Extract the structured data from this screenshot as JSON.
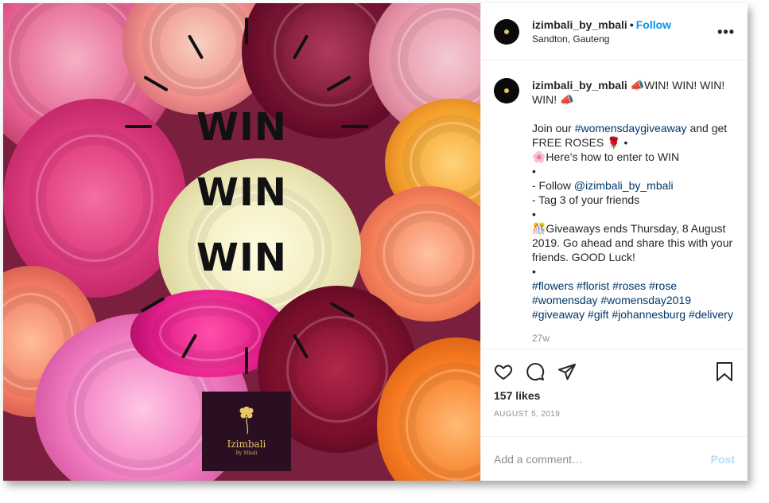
{
  "post": {
    "username": "izimbali_by_mbali",
    "follow_label": "Follow",
    "dot": "•",
    "location": "Sandton, Gauteng",
    "more": "•••",
    "image": {
      "words": [
        "WIN",
        "WIN",
        "WIN"
      ],
      "logo_name": "Izimbali",
      "logo_sub": "By Mbali"
    },
    "caption": {
      "username": "izimbali_by_mbali",
      "lines": [
        {
          "type": "text",
          "text": " 📣WIN! WIN! WIN! WIN! 📣"
        }
      ],
      "para1_prefix": "Join our ",
      "para1_tag": "#womensdaygiveaway",
      "para1_suffix": " and get FREE ROSES 🌹 •",
      "howto": "🌸Here's how to enter to WIN",
      "bullet": "•",
      "follow_prefix": "- Follow ",
      "follow_mention": "@izimbali_by_mbali",
      "tag_line": "- Tag 3 of your friends",
      "giveaway": "🎊Giveaways ends Thursday, 8 August 2019. Go ahead and share this with your friends. GOOD Luck!",
      "hashtags": [
        "#flowers",
        "#florist",
        "#roses",
        "#rose",
        "#womensday",
        "#womensday2019",
        "#giveaway",
        "#gift",
        "#johannesburg",
        "#delivery"
      ]
    },
    "time_ago": "27w",
    "likes": "157 likes",
    "date": "AUGUST 5, 2019",
    "comment_placeholder": "Add a comment…",
    "post_label": "Post"
  },
  "colors": {
    "link_blue": "#0095f6",
    "hashtag": "#00376b",
    "muted": "#8e8e8e",
    "post_disabled": "#b2dffc"
  },
  "icons": [
    "heart-icon",
    "comment-icon",
    "share-icon",
    "bookmark-icon",
    "more-options-icon"
  ]
}
